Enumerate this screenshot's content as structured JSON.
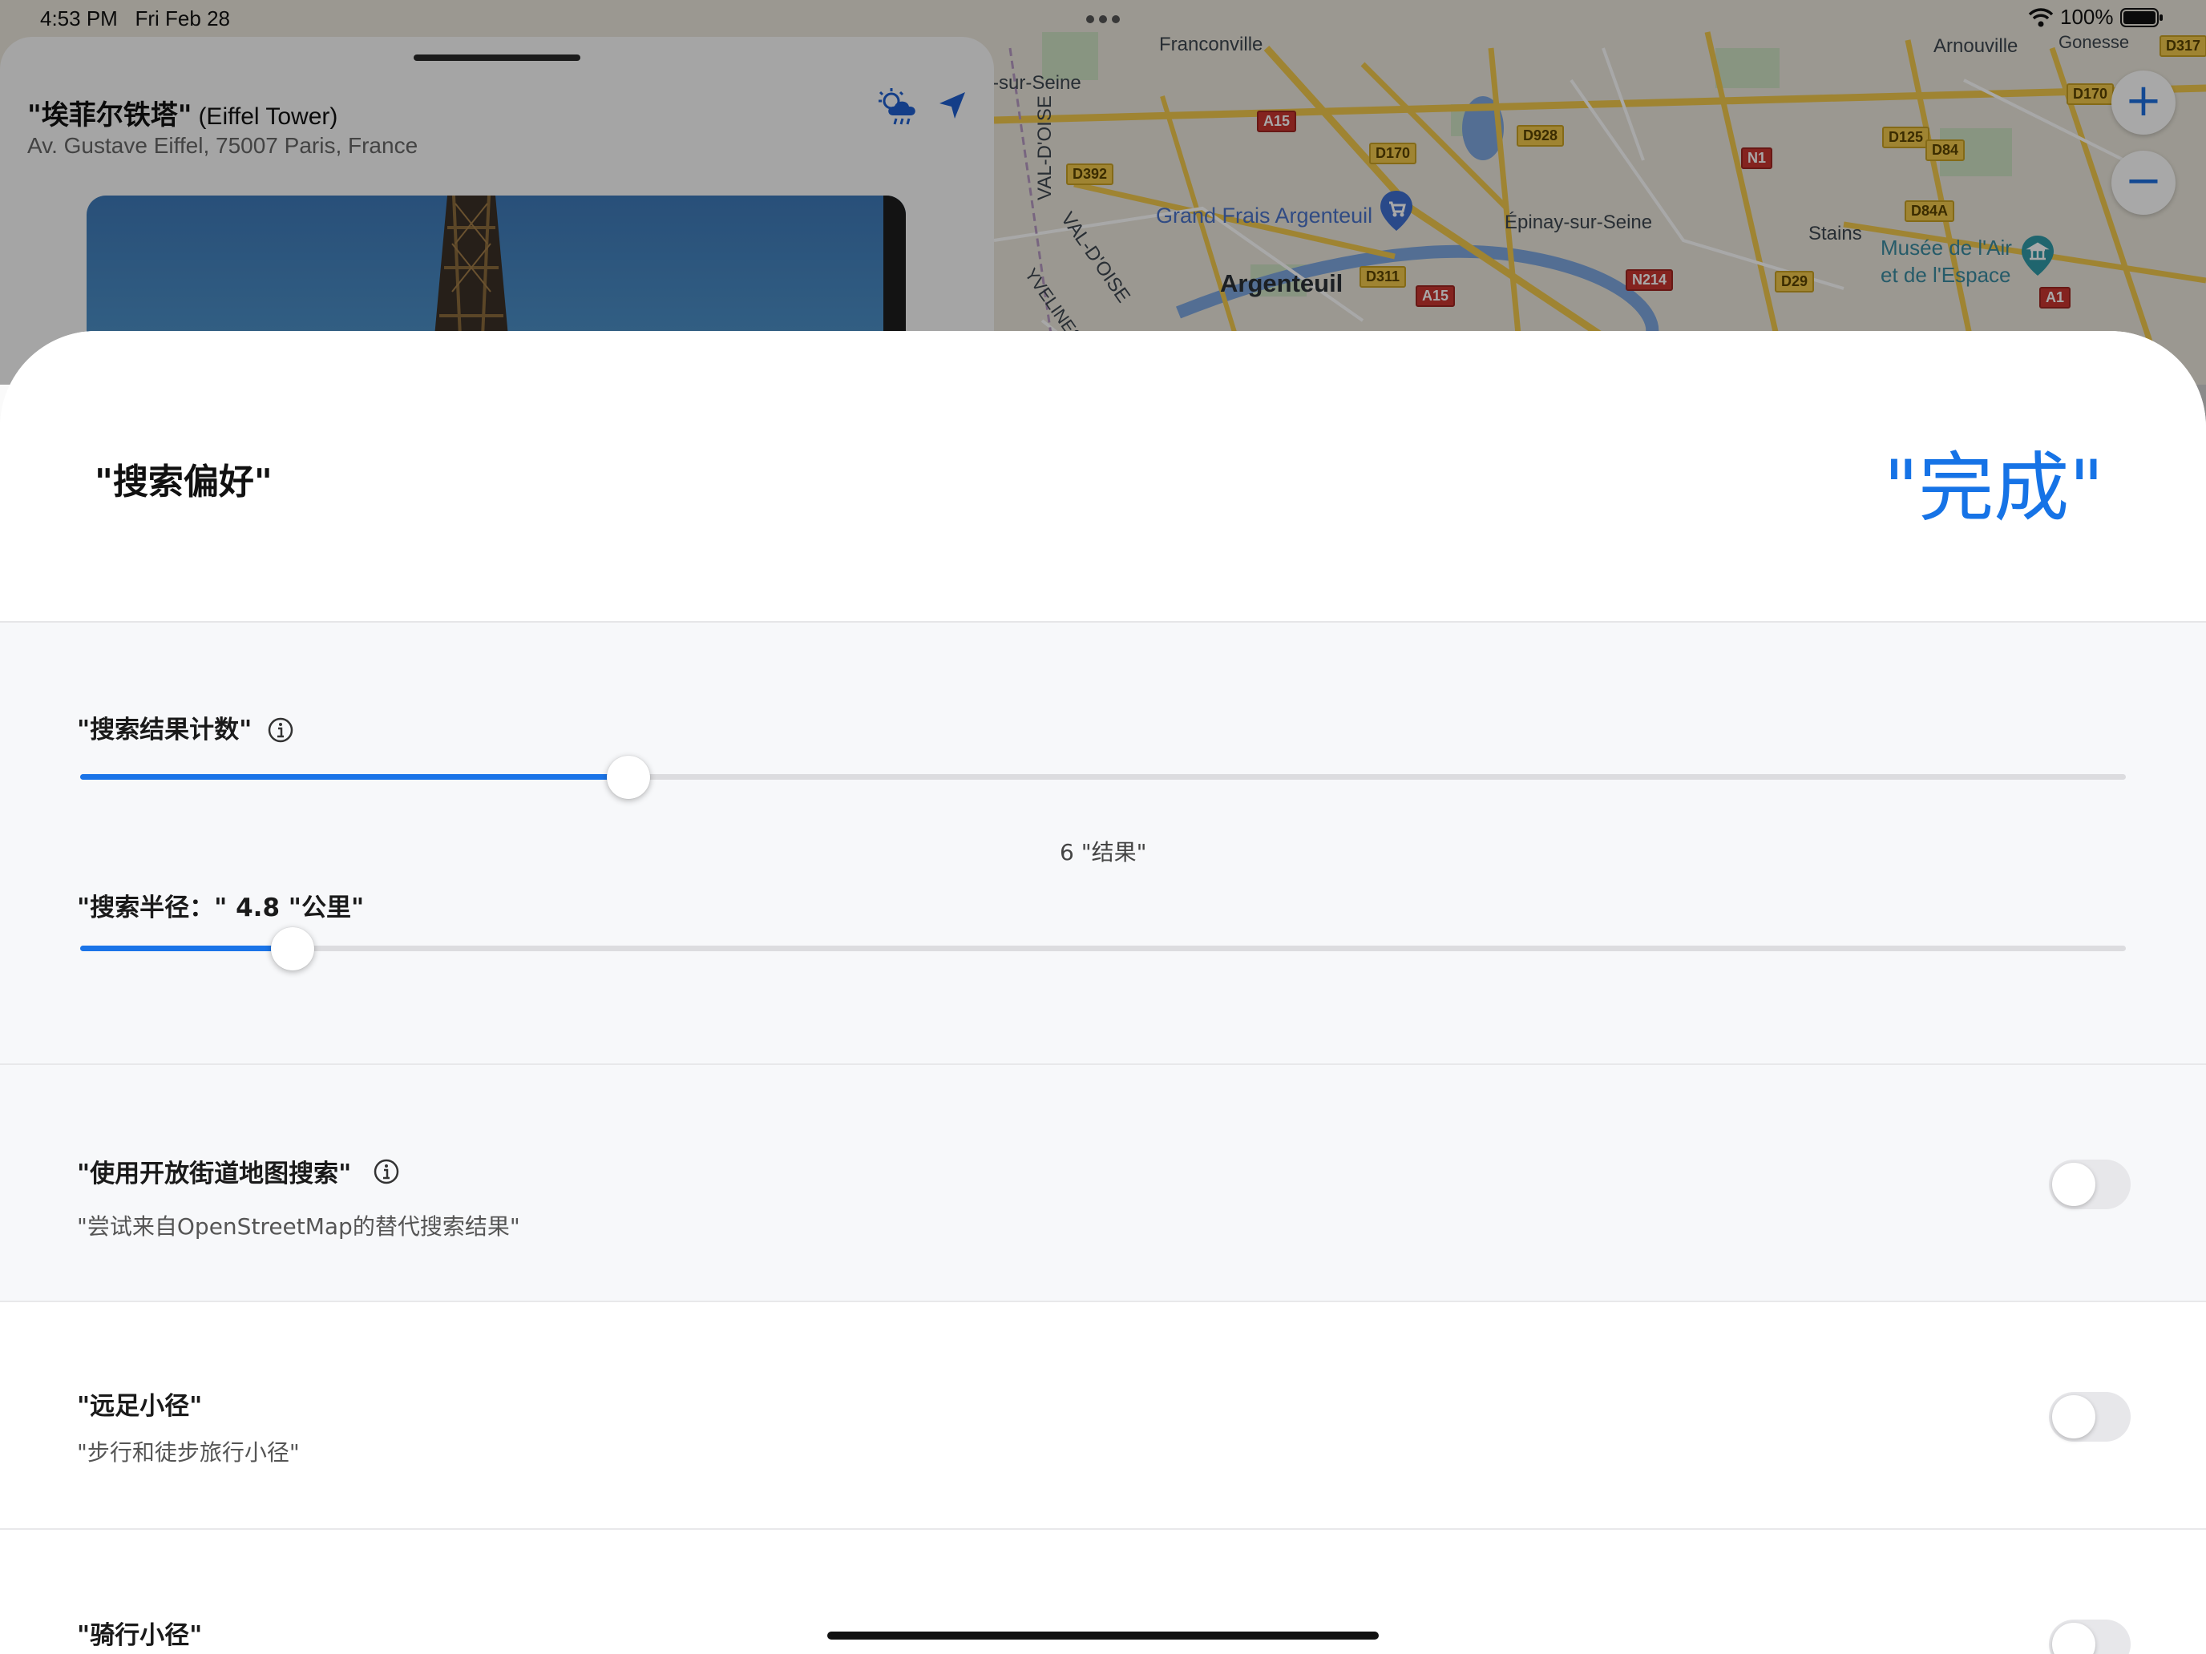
{
  "status_bar": {
    "time": "4:53 PM",
    "date": "Fri Feb 28",
    "battery": "100%",
    "icons": [
      "wifi-icon",
      "battery-icon",
      "multitask-dots-icon"
    ]
  },
  "map": {
    "labels": {
      "franconville": "Franconville",
      "arnouville": "Arnouville",
      "gonesse": "Gonesse",
      "sur_seine": "-sur-Seine",
      "val_doise_vertical": "VAL-D'OISE",
      "val_doise_diag": "VAL-D'OISE",
      "yvelines": "YVELINES",
      "grand_frais": "Grand Frais Argenteuil",
      "epinay": "Épinay-sur-Seine",
      "stains": "Stains",
      "musee_line1": "Musée de l'Air",
      "musee_line2": "et de l'Espace",
      "argenteuil": "Argenteuil"
    },
    "road_shields": {
      "d317": "D317",
      "d170_a": "D170",
      "d170_b": "D170",
      "a15_a": "A15",
      "d928": "D928",
      "n1": "N1",
      "d125": "D125",
      "d84": "D84",
      "d392": "D392",
      "d84a": "D84A",
      "d311": "D311",
      "a15_b": "A15",
      "n214": "N214",
      "d29": "D29",
      "a1": "A1"
    },
    "zoom_in": "+",
    "zoom_out": "−",
    "colors": {
      "land": "#ebe7dc",
      "road": "#f2c94c",
      "water": "#7fa8e0"
    }
  },
  "place_panel": {
    "title_cn": "\"埃菲尔铁塔\"",
    "title_en": "(Eiffel Tower)",
    "address": "Av. Gustave Eiffel, 75007 Paris, France"
  },
  "sheet": {
    "title": "\"搜索偏好\"",
    "done_label": "\"完成\"",
    "result_count": {
      "label": "\"搜索结果计数\"",
      "value_text": "6 \"结果\"",
      "value": 6,
      "fraction": 0.268
    },
    "radius": {
      "label": "\"搜索半径：\" 4.8 \"公里\"",
      "value": 4.8,
      "fraction": 0.104
    },
    "osm": {
      "label": "\"使用开放街道地图搜索\"",
      "description": "\"尝试来自OpenStreetMap的替代搜索结果\"",
      "enabled": false
    },
    "hiking": {
      "label": "\"远足小径\"",
      "description": "\"步行和徒步旅行小径\"",
      "enabled": false
    },
    "cycling": {
      "label": "\"骑行小径\"",
      "enabled": false
    },
    "accent_color": "#1a74e8"
  }
}
